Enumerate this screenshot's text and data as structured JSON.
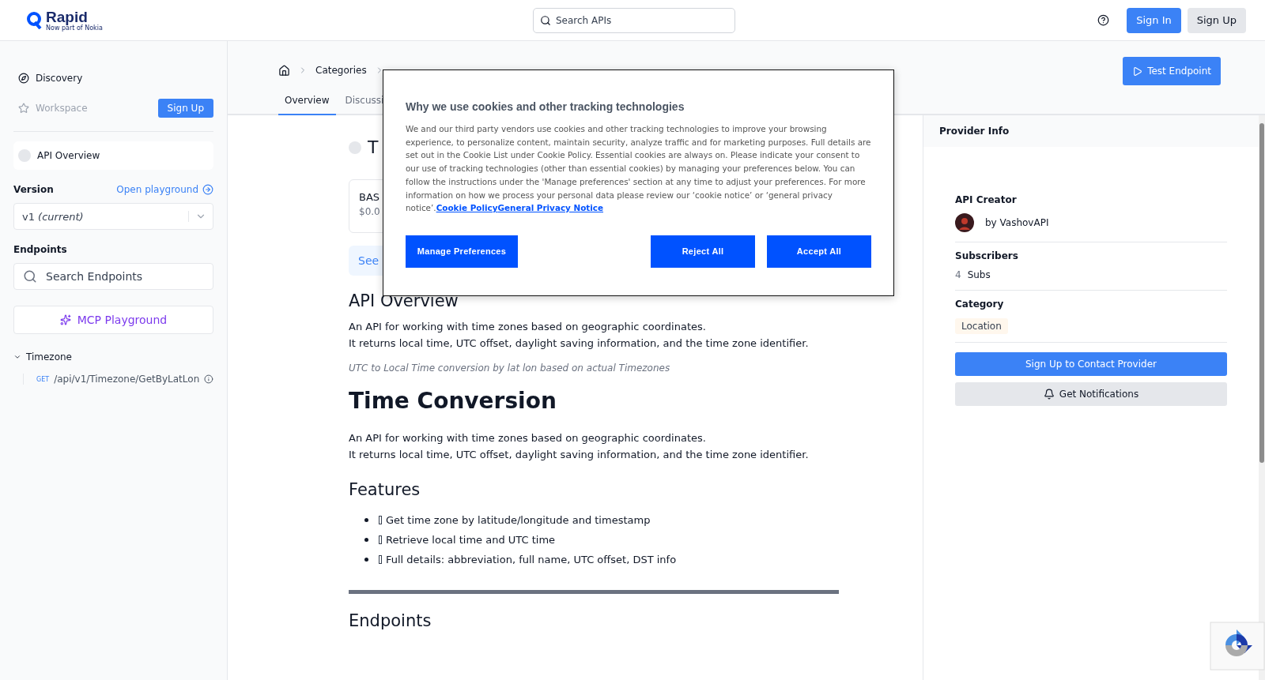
{
  "header": {
    "logo": "Rapid",
    "logo_subtitle": "Now part of Nokia",
    "search": {
      "placeholder": "Search APIs"
    },
    "buttons": [
      {
        "label": "Sign In",
        "kind": "primary"
      },
      {
        "label": "Sign Up",
        "kind": "secondary"
      }
    ]
  },
  "sidebar": {
    "nav": [
      {
        "label": "Discovery",
        "disabled": false
      },
      {
        "label": "Workspace",
        "disabled": true
      }
    ],
    "signup": "Sign Up",
    "api_overview": "API Overview",
    "version_label": "Version",
    "open_playground": "Open playground",
    "version": {
      "value": "v1",
      "note": "(current)"
    },
    "endpoints_label": "Endpoints",
    "endpoint_search": {
      "placeholder": "Search Endpoints"
    },
    "mcp": "MCP Playground",
    "tree": [
      {
        "label": "Timezone",
        "expanded": true,
        "children": [
          {
            "method": "GET",
            "path": "/api/v1/Timezone/GetByLatLon"
          }
        ]
      }
    ]
  },
  "breadcrumb": [
    "Categories"
  ],
  "tabs": [
    {
      "label": "Overview",
      "selected": true
    },
    {
      "label": "Discussi",
      "selected": false
    }
  ],
  "test_endpoint": "Test Endpoint",
  "content": {
    "title": "T",
    "plan": {
      "name": "BAS",
      "price": "$0.0"
    },
    "see": "See",
    "overview_heading": "API Overview",
    "overview_lines": [
      "An API for working with time zones based on geographic coordinates.",
      "It returns local time, UTC offset, daylight saving information, and the time zone identifier."
    ],
    "caption": "UTC to Local Time conversion by lat lon based on actual Timezones",
    "h1": "Time Conversion",
    "lines": [
      "An API for working with time zones based on geographic coordinates.",
      "It returns local time, UTC offset, daylight saving information, and the time zone identifier."
    ],
    "features_heading": "Features",
    "features": [
      "Get time zone by latitude/longitude and timestamp",
      "Retrieve local time and UTC time",
      "Full details: abbreviation, full name, UTC offset, DST info"
    ],
    "endpoints_heading": "Endpoints"
  },
  "provider": {
    "title": "Provider Info",
    "creator_label": "API Creator",
    "creator": "by VashovAPI",
    "subscribers_label": "Subscribers",
    "sub_count": "4",
    "sub_unit": "Subs",
    "category_label": "Category",
    "category": "Location",
    "contact": "Sign Up to Contact Provider",
    "notify": "Get Notifications"
  },
  "cookie": {
    "title": "Why we use cookies and other tracking technologies",
    "body": "We and our third party vendors use cookies and other tracking technologies to improve your browsing experience, to personalize content, maintain security, analyze traffic and for marketing purposes. Full details are set out in the Cookie List under Cookie Policy. Essential cookies are always on. Please indicate your consent to our use of tracking technologies (other than essential cookies) by managing your preferences below. You can follow the instructions under the 'Manage preferences' section at any time to adjust your preferences. For more information on how we process your personal data please review our ‘cookie notice’ or ‘general privacy notice’.",
    "links": [
      "Cookie Policy",
      "General Privacy Notice"
    ],
    "buttons": [
      "Manage Preferences",
      "Reject All",
      "Accept All"
    ]
  }
}
